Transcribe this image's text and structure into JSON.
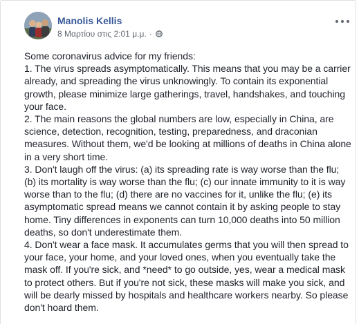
{
  "post": {
    "author": "Manolis Kellis",
    "timestamp": "8 Μαρτίου στις 2:01 μ.μ.",
    "separator": "·",
    "privacy_icon": "globe-icon",
    "more_icon": "more-options-icon",
    "paragraphs": [
      "Some coronavirus advice for my friends:",
      "1. The virus spreads asymptomatically. This means that you may be a carrier already, and spreading the virus unknowingly. To contain its exponential growth, please minimize large gatherings, travel, handshakes, and touching your face.",
      "2. The main reasons the global numbers are low, especially in China, are science, detection, recognition, testing, preparedness, and draconian measures. Without them, we'd be looking at millions of deaths in China alone in a very short time.",
      "3. Don't laugh off the virus: (a) its spreading rate is way worse than the flu; (b) its mortality is way worse than the flu; (c) our innate immunity to it is way worse than to the flu; (d) there are no vaccines for it, unlike the flu; (e) its asymptomatic spread means we cannot contain it by asking people to stay home. Tiny differences in exponents can turn 10,000 deaths into 50 million deaths, so don't underestimate them.",
      "4. Don't wear a face mask. It accumulates germs that you will then spread to your face, your home, and your loved ones, when you eventually take the mask off. If you're sick, and *need* to go outside, yes, wear a medical mask to protect others. But if you're not sick, these masks will make you sick, and will be dearly missed by hospitals and healthcare workers nearby. So please don't hoard them."
    ]
  },
  "colors": {
    "author_link": "#385898",
    "meta_text": "#616770",
    "body_text": "#1d2129",
    "border": "#dddfe2"
  }
}
